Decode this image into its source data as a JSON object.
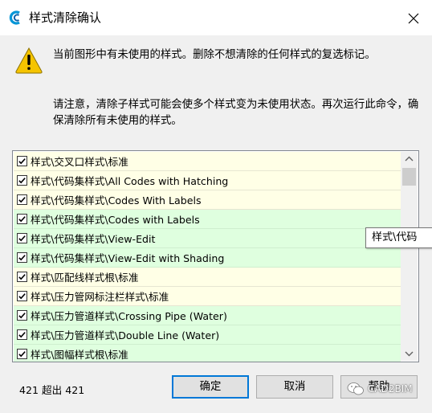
{
  "window": {
    "title": "样式清除确认",
    "close_icon": "close-icon"
  },
  "message": {
    "icon": "warning-icon",
    "line1": "当前图形中有未使用的样式。删除不想清除的任何样式的复选标记。",
    "line2": "请注意，清除子样式可能会使多个样式变为未使用状态。再次运行此命令，确保清除所有未使用的样式。"
  },
  "styles_list": {
    "rows": [
      {
        "label": "样式\\交叉口样式\\标准",
        "checked": true,
        "tint": "yellow"
      },
      {
        "label": "样式\\代码集样式\\All Codes with Hatching",
        "checked": true,
        "tint": "yellow"
      },
      {
        "label": "样式\\代码集样式\\Codes With Labels",
        "checked": true,
        "tint": "yellow"
      },
      {
        "label": "样式\\代码集样式\\Codes with Labels",
        "checked": true,
        "tint": "green"
      },
      {
        "label": "样式\\代码集样式\\View-Edit",
        "checked": true,
        "tint": "green"
      },
      {
        "label": "样式\\代码集样式\\View-Edit with Shading",
        "checked": true,
        "tint": "green"
      },
      {
        "label": "样式\\匹配线样式根\\标准",
        "checked": true,
        "tint": "yellow"
      },
      {
        "label": "样式\\压力管网标注栏样式\\标准",
        "checked": true,
        "tint": "yellow"
      },
      {
        "label": "样式\\压力管道样式\\Crossing Pipe (Water)",
        "checked": true,
        "tint": "green"
      },
      {
        "label": "样式\\压力管道样式\\Double Line (Water)",
        "checked": true,
        "tint": "green"
      },
      {
        "label": "样式\\图幅样式根\\标准",
        "checked": true,
        "tint": "green"
      }
    ],
    "tooltip": "样式\\代码"
  },
  "footer": {
    "count_text": "421 超出 421",
    "ok_label": "确定",
    "cancel_label": "取消",
    "help_label": "帮助"
  },
  "watermark": {
    "text": "CAD2BIM"
  },
  "colors": {
    "accent": "#0078d7",
    "row_yellow": "#ffffe6",
    "row_green": "#dfffdf",
    "warning": "#f5c400"
  }
}
